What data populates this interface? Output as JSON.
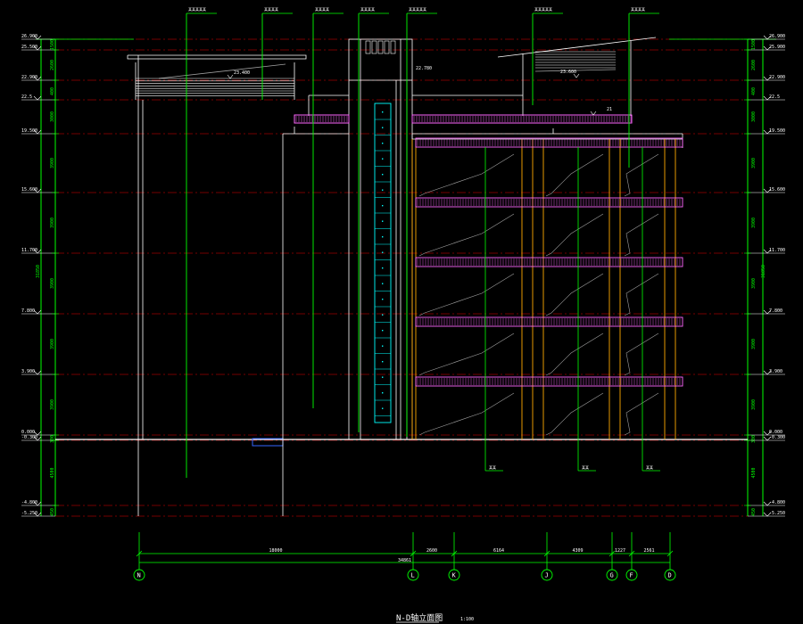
{
  "colors": {
    "background": "#000000",
    "green": "#00ff00",
    "white": "#ffffff",
    "yellow": "#ffff00",
    "magenta": "#ff66ff",
    "red_dash": "#990000",
    "cyan": "#00ffff",
    "orange": "#ffaa00",
    "gray": "#a0a0a0",
    "blue": "#3366ff"
  },
  "elevations_left": [
    "26.900",
    "25.500",
    "22.900",
    "22.5",
    "19.500",
    "15.600",
    "11.700",
    "7.800",
    "3.900",
    "0.000",
    "-0.300",
    "-4.800",
    "-5.250"
  ],
  "elevations_right": [
    "26.900",
    "25.900",
    "22.900",
    "22.5",
    "19.500",
    "15.600",
    "11.700",
    "7.800",
    "3.900",
    "0.000",
    "-0.300",
    "-4.800",
    "-5.250"
  ],
  "dims_left": [
    "1500",
    "2600",
    "400",
    "3000",
    "3900",
    "3900",
    "3900",
    "3900",
    "3900",
    "300",
    "4500",
    "450"
  ],
  "dims_right": [
    "1500",
    "2600",
    "400",
    "3000",
    "3900",
    "3900",
    "3900",
    "3900",
    "3900",
    "300",
    "4500",
    "450"
  ],
  "total_height_label": "31850",
  "axes": [
    "N",
    "L",
    "K",
    "J",
    "G",
    "F",
    "D"
  ],
  "axis_dims": [
    "18000",
    "2600",
    "6164",
    "4309",
    "1227",
    "2561"
  ],
  "axis_total": "34861",
  "elevation_marks_top": [
    "23.400",
    "23.600",
    "22.780",
    "21"
  ],
  "top_callouts": [
    "某某某某某",
    "某某某某",
    "某某某某",
    "某某某某",
    "某某某某某",
    "某某某某某",
    "某某某某"
  ],
  "bottom_callouts": [
    "某某",
    "某某",
    "某某"
  ],
  "title": "N-D轴立面图",
  "scale": "1:100"
}
